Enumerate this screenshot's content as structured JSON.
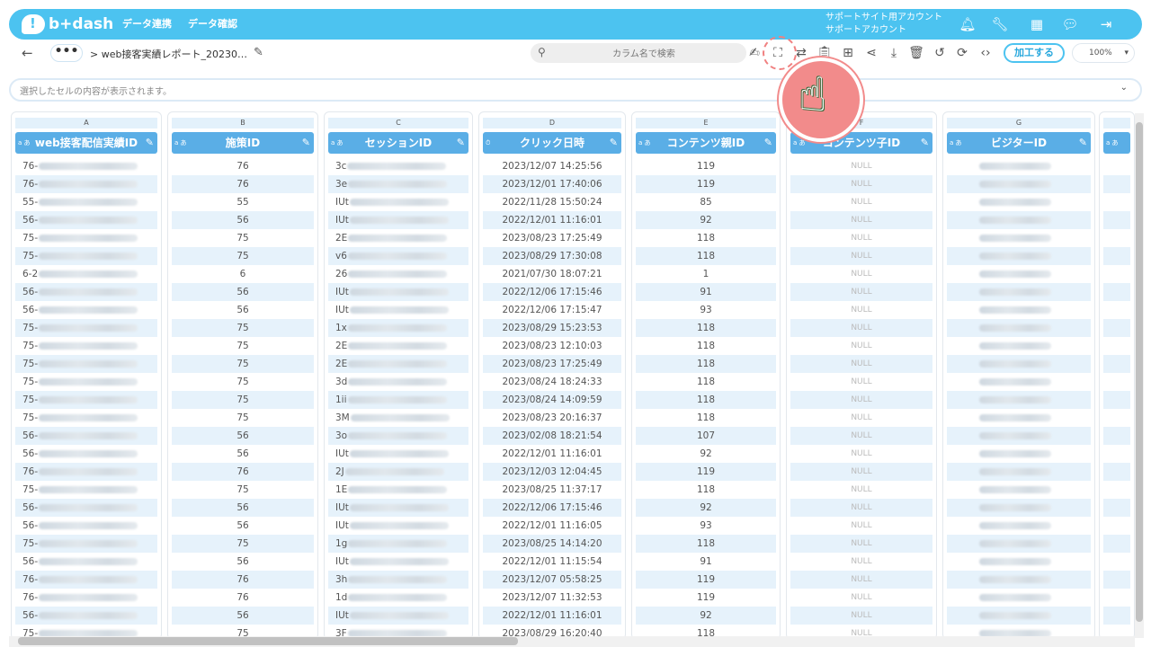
{
  "header": {
    "logo_text": "b+dash",
    "nav": [
      {
        "label": "データ連携"
      },
      {
        "label": "データ確認"
      }
    ],
    "account_line1": "サポートサイト用アカウント",
    "account_line2": "サポートアカウント"
  },
  "toolbar": {
    "dots": "•••",
    "breadcrumb": "> web接客実績レポート_20230…",
    "search_placeholder": "カラム名で検索",
    "process_label": "加工する",
    "zoom_value": "100%"
  },
  "cellbar": {
    "text": "選択したセルの内容が表示されます。"
  },
  "columns": [
    {
      "letter": "A",
      "name": "web接客配信実績ID",
      "type_tag": "a あ",
      "kind": "blur",
      "values": [
        "76-",
        "76-",
        "55-",
        "56-",
        "75-",
        "75-",
        "6-2",
        "56-",
        "56-",
        "75-",
        "75-",
        "75-",
        "75-",
        "75-",
        "75-",
        "56-",
        "56-",
        "76-",
        "75-",
        "56-",
        "56-",
        "75-",
        "56-",
        "76-",
        "76-",
        "56-",
        "75-"
      ]
    },
    {
      "letter": "B",
      "name": "施策ID",
      "type_tag": "a あ",
      "kind": "num",
      "values": [
        "76",
        "76",
        "55",
        "56",
        "75",
        "75",
        "6",
        "56",
        "56",
        "75",
        "75",
        "75",
        "75",
        "75",
        "75",
        "56",
        "56",
        "76",
        "75",
        "56",
        "56",
        "75",
        "56",
        "76",
        "76",
        "56",
        "75"
      ]
    },
    {
      "letter": "C",
      "name": "セッションID",
      "type_tag": "a あ",
      "kind": "blur",
      "values": [
        "3c",
        "3e",
        "IUt",
        "IUt",
        "2E",
        "v6",
        "26",
        "IUt",
        "IUt",
        "1x",
        "2E",
        "2E",
        "3d",
        "1ii",
        "3M",
        "3o",
        "IUt",
        "2J",
        "1E",
        "IUt",
        "IUt",
        "1g",
        "IUt",
        "3h",
        "1d",
        "IUt",
        "3F"
      ]
    },
    {
      "letter": "D",
      "name": "クリック日時",
      "type_tag": "⏱",
      "kind": "date",
      "values": [
        "2023/12/07 14:25:56",
        "2023/12/01 17:40:06",
        "2022/11/28 15:50:24",
        "2022/12/01 11:16:01",
        "2023/08/23 17:25:49",
        "2023/08/29 17:30:08",
        "2021/07/30 18:07:21",
        "2022/12/06 17:15:46",
        "2022/12/06 17:15:47",
        "2023/08/29 15:23:53",
        "2023/08/23 12:10:03",
        "2023/08/23 17:25:49",
        "2023/08/24 18:24:33",
        "2023/08/24 14:09:59",
        "2023/08/23 20:16:37",
        "2023/02/08 18:21:54",
        "2022/12/01 11:16:01",
        "2023/12/03 12:04:45",
        "2023/08/25 11:37:17",
        "2022/12/06 17:15:46",
        "2022/12/01 11:16:05",
        "2023/08/25 14:14:20",
        "2022/12/01 11:15:54",
        "2023/12/07 05:58:25",
        "2023/12/07 11:32:53",
        "2022/12/01 11:16:01",
        "2023/08/29 16:20:40"
      ]
    },
    {
      "letter": "E",
      "name": "コンテンツ親ID",
      "type_tag": "a あ",
      "kind": "num",
      "values": [
        "119",
        "119",
        "85",
        "92",
        "118",
        "118",
        "1",
        "91",
        "93",
        "118",
        "118",
        "118",
        "118",
        "118",
        "118",
        "107",
        "92",
        "119",
        "118",
        "92",
        "93",
        "118",
        "91",
        "119",
        "119",
        "92",
        "118"
      ]
    },
    {
      "letter": "F",
      "name": "コンテンツ子ID",
      "type_tag": "a あ",
      "kind": "null",
      "values": [
        "NULL",
        "NULL",
        "NULL",
        "NULL",
        "NULL",
        "NULL",
        "NULL",
        "NULL",
        "NULL",
        "NULL",
        "NULL",
        "NULL",
        "NULL",
        "NULL",
        "NULL",
        "NULL",
        "NULL",
        "NULL",
        "NULL",
        "NULL",
        "NULL",
        "NULL",
        "NULL",
        "NULL",
        "NULL",
        "NULL",
        "NULL"
      ]
    },
    {
      "letter": "G",
      "name": "ビジターID",
      "type_tag": "a あ",
      "kind": "blurfull",
      "values": [
        "",
        "",
        "",
        "",
        "",
        "",
        "",
        "",
        "",
        "",
        "",
        "",
        "",
        "",
        "",
        "",
        "",
        "",
        "",
        "",
        "",
        "",
        "",
        "",
        "",
        "",
        ""
      ]
    },
    {
      "letter": "",
      "name": "",
      "type_tag": "a あ",
      "kind": "blurfull",
      "values": [
        "",
        "",
        "",
        "",
        "",
        "",
        "",
        "",
        "",
        "",
        "",
        "",
        "",
        "",
        "",
        "",
        "",
        "",
        "",
        "",
        "",
        "",
        "",
        "",
        "",
        "",
        ""
      ]
    }
  ],
  "colors": {
    "brand": "#4cc3f0",
    "header_col": "#5aaee6",
    "row_alt": "#e6f2fb",
    "hand": "#f28b8b"
  }
}
